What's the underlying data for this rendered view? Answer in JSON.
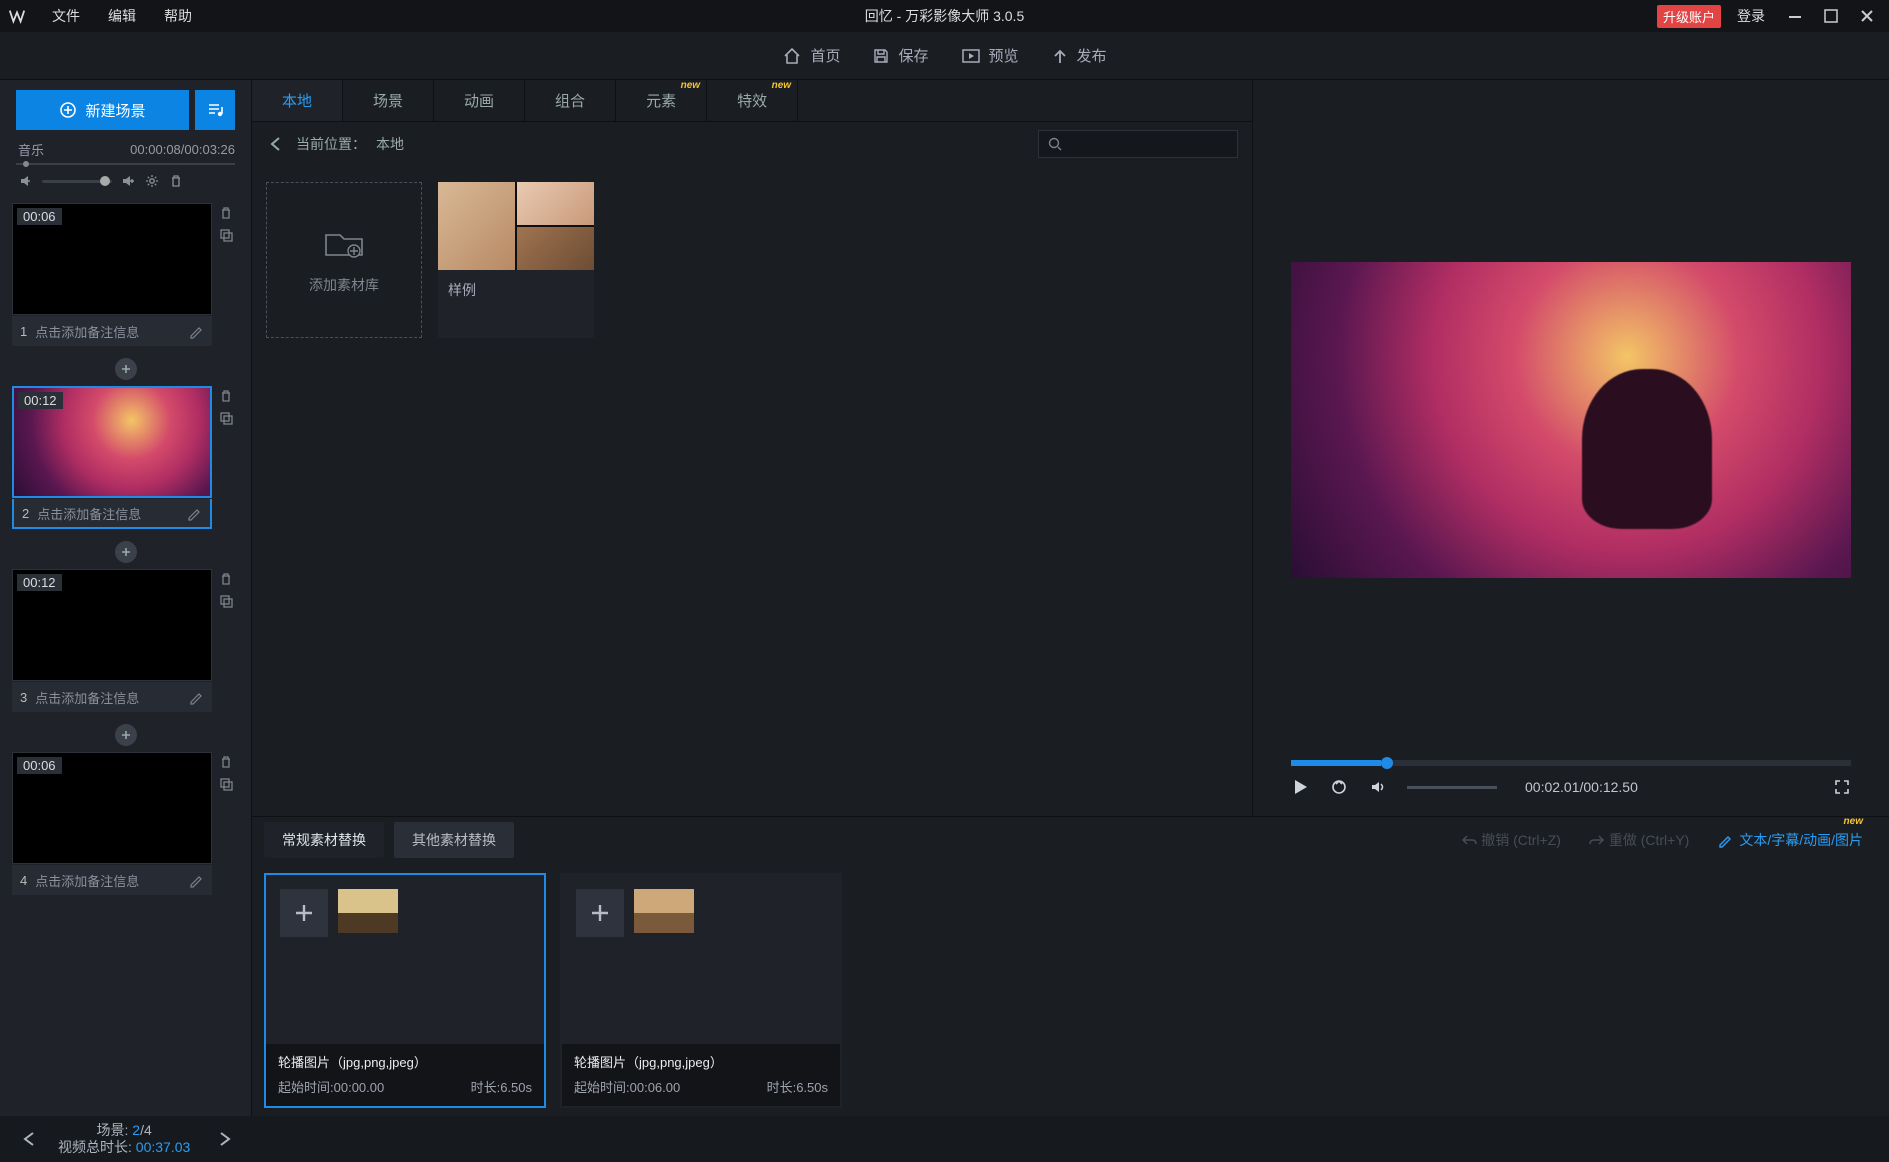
{
  "titlebar": {
    "menu": {
      "file": "文件",
      "edit": "编辑",
      "help": "帮助"
    },
    "app_title": "回忆 - 万彩影像大师 3.0.5",
    "upgrade": "升级账户",
    "login": "登录"
  },
  "actionbar": {
    "home": "首页",
    "save": "保存",
    "preview": "预览",
    "publish": "发布"
  },
  "left": {
    "new_scene": "新建场景",
    "music_label": "音乐",
    "music_time": "00:00:08/00:03:26",
    "scenes": [
      {
        "index": "1",
        "duration": "00:06",
        "caption": "点击添加备注信息"
      },
      {
        "index": "2",
        "duration": "00:12",
        "caption": "点击添加备注信息"
      },
      {
        "index": "3",
        "duration": "00:12",
        "caption": "点击添加备注信息"
      },
      {
        "index": "4",
        "duration": "00:06",
        "caption": "点击添加备注信息"
      }
    ]
  },
  "asset_tabs": {
    "local": "本地",
    "scene": "场景",
    "animation": "动画",
    "combo": "组合",
    "element": "元素",
    "effect": "特效",
    "new_badge": "new"
  },
  "asset_path": {
    "label": "当前位置：",
    "value": "本地"
  },
  "asset_grid": {
    "add_library": "添加素材库",
    "sample": "样例"
  },
  "bottom": {
    "tab_regular": "常规素材替换",
    "tab_other": "其他素材替换",
    "undo": "撤销 (Ctrl+Z)",
    "redo": "重做 (Ctrl+Y)",
    "link_text": "文本/字幕/动画/图片",
    "new_badge": "new",
    "cards": [
      {
        "title": "轮播图片（jpg,png,jpeg）",
        "start_label": "起始时间:",
        "start": "00:00.00",
        "dur_label": "时长:",
        "dur": "6.50s"
      },
      {
        "title": "轮播图片（jpg,png,jpeg）",
        "start_label": "起始时间:",
        "start": "00:06.00",
        "dur_label": "时长:",
        "dur": "6.50s"
      }
    ]
  },
  "preview": {
    "time": "00:02.01/00:12.50"
  },
  "status": {
    "scene_label": "场景:",
    "scene_current": "2",
    "scene_sep": "/",
    "scene_total": "4",
    "total_label": "视频总时长:",
    "total_value": "00:37.03"
  }
}
